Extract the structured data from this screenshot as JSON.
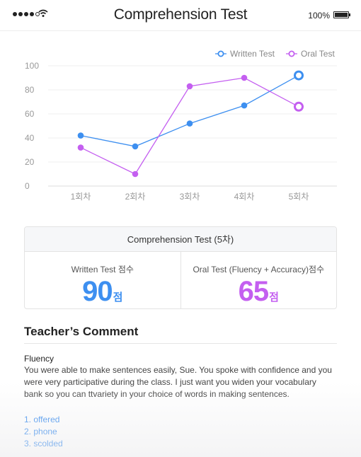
{
  "status_bar": {
    "battery_text": "100%",
    "battery_level": 1.0
  },
  "app": {
    "title": "Comprehension Test"
  },
  "chart_data": {
    "type": "line",
    "categories": [
      "1회차",
      "2회차",
      "3회차",
      "4회차",
      "5회차"
    ],
    "series": [
      {
        "name": "Written Test",
        "values": [
          42,
          33,
          52,
          67,
          92
        ],
        "color": "#3d8ff0"
      },
      {
        "name": "Oral Test",
        "values": [
          32,
          10,
          83,
          90,
          66
        ],
        "color": "#c45ff0"
      }
    ],
    "ylim": [
      0,
      100
    ],
    "yticks": [
      "100",
      "80",
      "60",
      "40",
      "20",
      "0"
    ],
    "grid": true,
    "legend_position": "top-right"
  },
  "summary": {
    "title": "Comprehension Test (5차)",
    "written_label": "Written Test 점수",
    "written_score": "90",
    "oral_label": "Oral Test (Fluency + Accuracy)점수",
    "oral_score": "65",
    "score_unit": "점"
  },
  "comment": {
    "title": "Teacher’s Comment",
    "heading": "Fluency",
    "body": "You were able to make sentences easily, Sue. You spoke with confidence and you were very participative  during the class. I just want you widen your vocabulary bank so you can ttvariety in your choice of words in making sentences.",
    "points": [
      "1. offered",
      "2. phone",
      "3. scolded"
    ]
  },
  "colors": {
    "written": "#3d8ff0",
    "oral": "#c45ff0"
  }
}
